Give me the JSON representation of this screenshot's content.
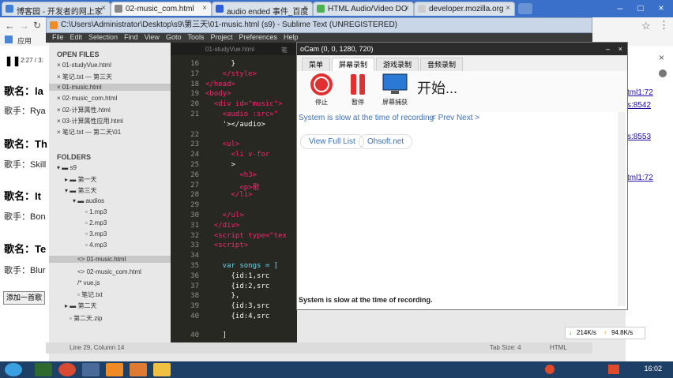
{
  "browser": {
    "tabs": [
      {
        "label": "博客园 - 开发者的网上家",
        "active": false
      },
      {
        "label": "02-music_com.html",
        "active": true
      },
      {
        "label": "audio ended 事件_百度",
        "active": false
      },
      {
        "label": "HTML Audio/Video DO",
        "active": false
      },
      {
        "label": "developer.mozilla.org",
        "active": false
      }
    ],
    "bookmarks_label": "应用",
    "address": ""
  },
  "page": {
    "player_time": "2:27 / 3:",
    "songs": [
      {
        "title": "歌名：la",
        "artist": "歌手：Rya"
      },
      {
        "title": "歌名：Th",
        "artist": "歌手：Skill"
      },
      {
        "title": "歌名：It",
        "artist": "歌手：Bon"
      },
      {
        "title": "歌名：Te",
        "artist": "歌手：Blur"
      }
    ],
    "add_button": "添加一首歌"
  },
  "right_page": {
    "links": [
      "tml1:72",
      "s:8542",
      "s:8553",
      "tml1:72"
    ]
  },
  "sublime": {
    "title": "C:\\Users\\Administrator\\Desktop\\s9\\第三天\\01-music.html (s9) - Sublime Text (UNREGISTERED)",
    "menu": [
      "File",
      "Edit",
      "Selection",
      "Find",
      "View",
      "Goto",
      "Tools",
      "Project",
      "Preferences",
      "Help"
    ],
    "editor_tabs": [
      "01-studyVue.html",
      "笔"
    ],
    "open_files_header": "OPEN FILES",
    "open_files": [
      "01-studyVue.html",
      "笔记.txt — 第三天",
      "01-music.html",
      "02-music_com.html",
      "02-计算属性.html",
      "03-计算属性应用.html",
      "笔记.txt — 第二天\\01"
    ],
    "folders_header": "FOLDERS",
    "folders": [
      "s9",
      "第一天",
      "第三天",
      "audios",
      "1.mp3",
      "2.mp3",
      "3.mp3",
      "4.mp3",
      "01-music.html",
      "02-music_com.html",
      "vue.js",
      "笔记.txt",
      "第二天",
      "第二天.zip"
    ],
    "line_numbers": [
      "16",
      "17",
      "18",
      "19",
      "20",
      "21",
      "",
      "22",
      "23",
      "24",
      "25",
      "26",
      "27",
      "28",
      "29",
      "30",
      "31",
      "32",
      "33",
      "34",
      "35",
      "36",
      "37",
      "38",
      "39",
      "40"
    ],
    "code_lines": [
      "      }",
      "    </style>",
      "</head>",
      "<body>",
      "  <div id=\"music\">",
      "    <audio :src=\"",
      "    '></audio>",
      "",
      "    <ul>",
      "      <li v-for",
      "      >",
      "        <h3>",
      "        <p>歌",
      "      </li>",
      "",
      "    </ul>",
      "  </div>",
      "  <script type=\"tex",
      "  <script>",
      "",
      "    var songs = [",
      "      {id:1,src",
      "      {id:2,src",
      "      },",
      "      {id:3,src",
      "      {id:4,src"
    ],
    "closing_line": "    ]",
    "status_left": "Line 29, Column 14",
    "status_tab": "Tab Size: 4",
    "status_syntax": "HTML"
  },
  "ocam": {
    "title": "oCam (0, 0, 1280, 720)",
    "tabs": [
      "菜单",
      "屏幕录制",
      "游戏录制",
      "音频录制"
    ],
    "tools": [
      "停止",
      "暂停",
      "屏幕捕获"
    ],
    "start_label": "开始...",
    "message_link": "System is slow at the time of recording",
    "prev_next": "< Prev Next >",
    "view_full": "View Full List",
    "site": "Ohsoft.net",
    "status": "System is slow at the time of recording."
  },
  "speed": {
    "down": "214K/s",
    "up": "94.8K/s"
  },
  "clock": "16:02",
  "colors": {
    "accent": "#3a70c9",
    "editor_bg": "#272822",
    "stop_red": "#e03030"
  }
}
